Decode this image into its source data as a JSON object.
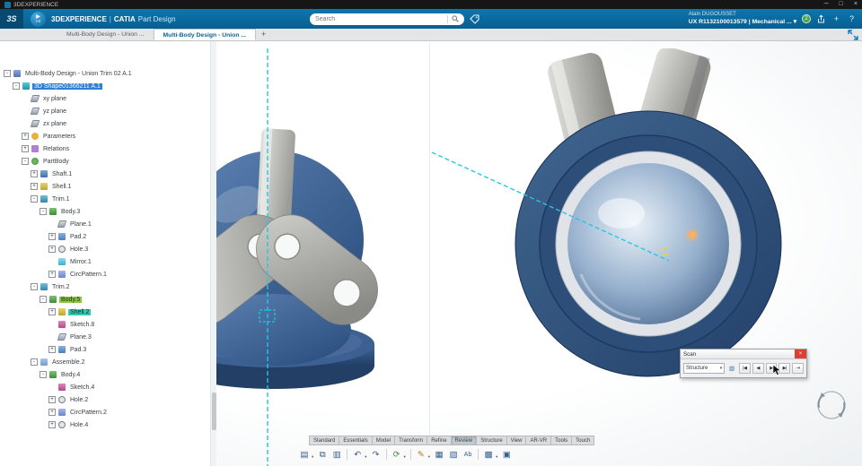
{
  "titlebar": {
    "title": "3DEXPERIENCE",
    "minimize": "─",
    "maximize": "□",
    "close": "×"
  },
  "header": {
    "brand": "3DEXPERIENCE",
    "pipe": "|",
    "app": "CATIA",
    "module": "Part Design",
    "logo": "3S",
    "play_glyph": "▶",
    "play_sub": "V.R",
    "search_placeholder": "Search",
    "user_name": "Alain DUGOUSSET",
    "workspace": "UX R1132100013579 | Mechanical ...",
    "workspace_caret": "▾",
    "status_badge": "2",
    "add_label": "+",
    "help_label": "?"
  },
  "doc_tabs": {
    "tabs": [
      {
        "label": "Multi-Body Design - Union ..."
      },
      {
        "label": "Multi-Body Design - Union ..."
      }
    ],
    "add": "+"
  },
  "tree": {
    "collapse_glyph": "-",
    "expand_glyph": "+",
    "items": [
      {
        "label": "Multi-Body Design - Union Trim 02 A.1",
        "icon": "assembly-icon"
      },
      {
        "label": "3D Shape01366211 A.1",
        "icon": "shape-icon"
      },
      {
        "label": "xy plane",
        "icon": "plane-icon"
      },
      {
        "label": "yz plane",
        "icon": "plane-icon"
      },
      {
        "label": "zx plane",
        "icon": "plane-icon"
      },
      {
        "label": "Parameters",
        "icon": "parameters-icon"
      },
      {
        "label": "Relations",
        "icon": "relations-icon"
      },
      {
        "label": "PartBody",
        "icon": "partbody-icon"
      },
      {
        "label": "Shaft.1",
        "icon": "shaft-icon"
      },
      {
        "label": "Shell.1",
        "icon": "shell-icon"
      },
      {
        "label": "Trim.1",
        "icon": "trim-icon"
      },
      {
        "label": "Body.3",
        "icon": "body-icon"
      },
      {
        "label": "Plane.1",
        "icon": "plane-icon"
      },
      {
        "label": "Pad.2",
        "icon": "pad-icon"
      },
      {
        "label": "Hole.3",
        "icon": "hole-icon"
      },
      {
        "label": "Mirror.1",
        "icon": "mirror-icon"
      },
      {
        "label": "CircPattern.1",
        "icon": "pattern-icon"
      },
      {
        "label": "Trim.2",
        "icon": "trim-icon"
      },
      {
        "label": "Body.5",
        "icon": "body-icon"
      },
      {
        "label": "Shell.2",
        "icon": "shell-icon"
      },
      {
        "label": "Sketch.8",
        "icon": "sketch-icon"
      },
      {
        "label": "Plane.3",
        "icon": "plane-icon"
      },
      {
        "label": "Pad.3",
        "icon": "pad-icon"
      },
      {
        "label": "Assemble.2",
        "icon": "assemble-icon"
      },
      {
        "label": "Body.4",
        "icon": "body-icon"
      },
      {
        "label": "Sketch.4",
        "icon": "sketch-icon"
      },
      {
        "label": "Hole.2",
        "icon": "hole-icon"
      },
      {
        "label": "CircPattern.2",
        "icon": "pattern-icon"
      },
      {
        "label": "Hole.4",
        "icon": "hole-icon"
      }
    ]
  },
  "scan": {
    "title": "Scan",
    "mode": "Structure",
    "caret": "▾",
    "list_glyph": "▥",
    "first": "|◀",
    "prev": "◀",
    "next": "▶",
    "last": "▶|",
    "exit": "⇥",
    "close": "×"
  },
  "ribbon": {
    "active": "Review",
    "tabs": [
      "Standard",
      "Essentials",
      "Model",
      "Transform",
      "Refine",
      "Review",
      "Structure",
      "View",
      "AR-VR",
      "Tools",
      "Touch"
    ],
    "caret": "▾",
    "tools": [
      {
        "name": "paste",
        "glyph": "▤"
      },
      {
        "name": "copy",
        "glyph": "⧉"
      },
      {
        "name": "clipboard",
        "glyph": "▥"
      },
      {
        "name": "undo",
        "glyph": "↶"
      },
      {
        "name": "redo",
        "glyph": "↷"
      },
      {
        "name": "update",
        "glyph": "⟳"
      },
      {
        "name": "annotate",
        "glyph": "✎"
      },
      {
        "name": "section",
        "glyph": "▦"
      },
      {
        "name": "snapshot",
        "glyph": "▧"
      },
      {
        "name": "text-check",
        "glyph": "Ab"
      },
      {
        "name": "display",
        "glyph": "▩"
      },
      {
        "name": "options",
        "glyph": "▣"
      }
    ]
  },
  "colors": {
    "accent_blue": "#0d76ae",
    "selection_blue": "#2f7fd6",
    "selection_green": "#8dc63f",
    "selection_teal": "#38c9b3",
    "scan_close_red": "#e03c31",
    "dash_cyan": "#1ec9e4"
  }
}
